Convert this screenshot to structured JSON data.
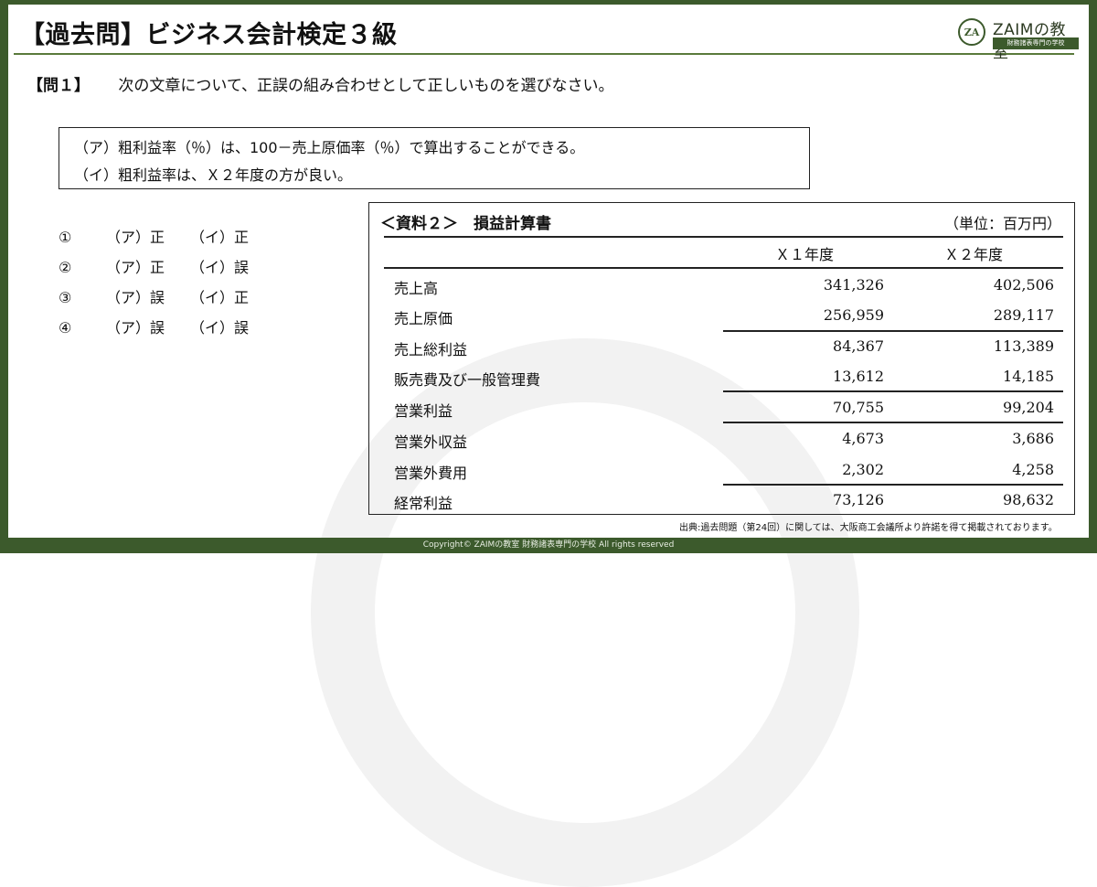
{
  "header": {
    "title": "【過去問】ビジネス会計検定３級",
    "logo_mark": "ZA",
    "logo_name": "ZAIMの教室",
    "logo_tagline": "財務諸表専門の学校"
  },
  "question": {
    "number": "【問１】",
    "text": "次の文章について、正誤の組み合わせとして正しいものを選びなさい。"
  },
  "statements": [
    "（ア）粗利益率（％）は、100－売上原価率（％）で算出することができる。",
    "（イ）粗利益率は、Ｘ２年度の方が良い。"
  ],
  "choices": [
    {
      "num": "①",
      "a": "（ア）正",
      "b": "（イ）正"
    },
    {
      "num": "②",
      "a": "（ア）正",
      "b": "（イ）誤"
    },
    {
      "num": "③",
      "a": "（ア）誤",
      "b": "（イ）正"
    },
    {
      "num": "④",
      "a": "（ア）誤",
      "b": "（イ）誤"
    }
  ],
  "statement_table": {
    "title": "＜資料２＞　損益計算書",
    "unit": "（単位：百万円）",
    "columns": [
      "Ｘ１年度",
      "Ｘ２年度"
    ],
    "rows": [
      {
        "label": "売上高",
        "x1": "341,326",
        "x2": "402,506"
      },
      {
        "label": "売上原価",
        "x1": "256,959",
        "x2": "289,117"
      },
      {
        "label": "売上総利益",
        "x1": "84,367",
        "x2": "113,389"
      },
      {
        "label": "販売費及び一般管理費",
        "x1": "13,612",
        "x2": "14,185"
      },
      {
        "label": "営業利益",
        "x1": "70,755",
        "x2": "99,204"
      },
      {
        "label": "営業外収益",
        "x1": "4,673",
        "x2": "3,686"
      },
      {
        "label": "営業外費用",
        "x1": "2,302",
        "x2": "4,258"
      },
      {
        "label": "経常利益",
        "x1": "73,126",
        "x2": "98,632"
      }
    ]
  },
  "source_note": "出典:過去問題（第24回）に関しては、大阪商工会議所より許諾を得て掲載されております。",
  "footer": "Copyright©  ZAIMの教室 財務諸表専門の学校 All rights reserved",
  "colors": {
    "brand_green": "#3c5a2c"
  }
}
